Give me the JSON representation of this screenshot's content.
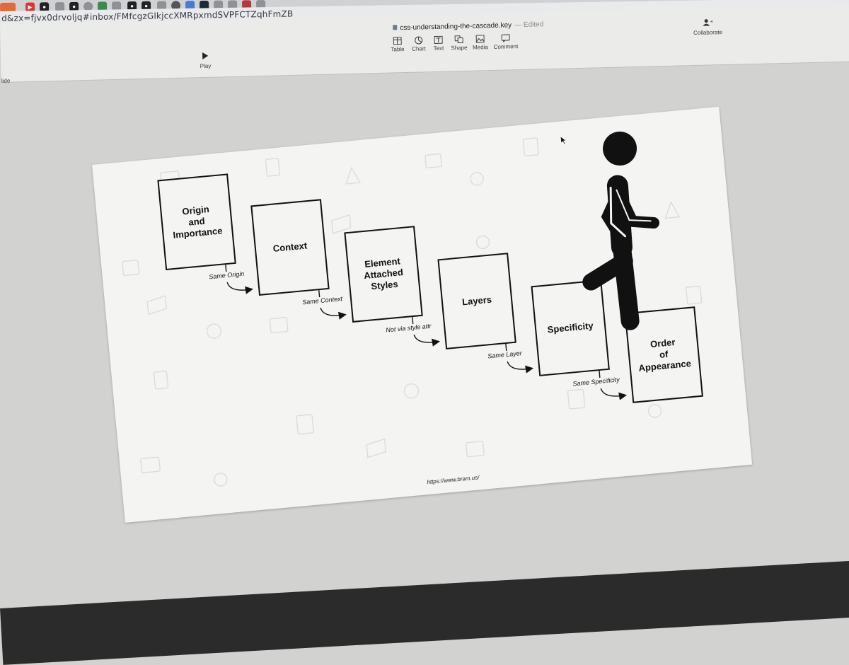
{
  "browser": {
    "url": "d&zx=fjvx0drvoljq#inbox/FMfcgzGlkjccXMRpxmdSVPFCTZqhFmZB"
  },
  "keynote": {
    "document_title": "css-understanding-the-cascade.key",
    "document_status": "— Edited",
    "play_label": "Play",
    "slide_label_partial": "lide",
    "collaborate_label": "Collaborate",
    "insert_buttons": [
      {
        "label": "Table",
        "icon": "table-icon"
      },
      {
        "label": "Chart",
        "icon": "chart-icon"
      },
      {
        "label": "Text",
        "icon": "text-icon"
      },
      {
        "label": "Shape",
        "icon": "shape-icon"
      },
      {
        "label": "Media",
        "icon": "media-icon"
      },
      {
        "label": "Comment",
        "icon": "comment-icon"
      }
    ]
  },
  "slide": {
    "steps": [
      {
        "l1": "Origin",
        "l2": "and",
        "l3": "Importance"
      },
      {
        "l1": "Context",
        "l2": "",
        "l3": ""
      },
      {
        "l1": "Element",
        "l2": "Attached",
        "l3": "Styles"
      },
      {
        "l1": "Layers",
        "l2": "",
        "l3": ""
      },
      {
        "l1": "Specificity",
        "l2": "",
        "l3": ""
      },
      {
        "l1": "Order",
        "l2": "of",
        "l3": "Appearance"
      }
    ],
    "connectors": [
      "Same Origin",
      "Same Context",
      "Not via style attr",
      "Same Layer",
      "Same Specificity"
    ],
    "footer_url": "https://www.bram.us/"
  }
}
